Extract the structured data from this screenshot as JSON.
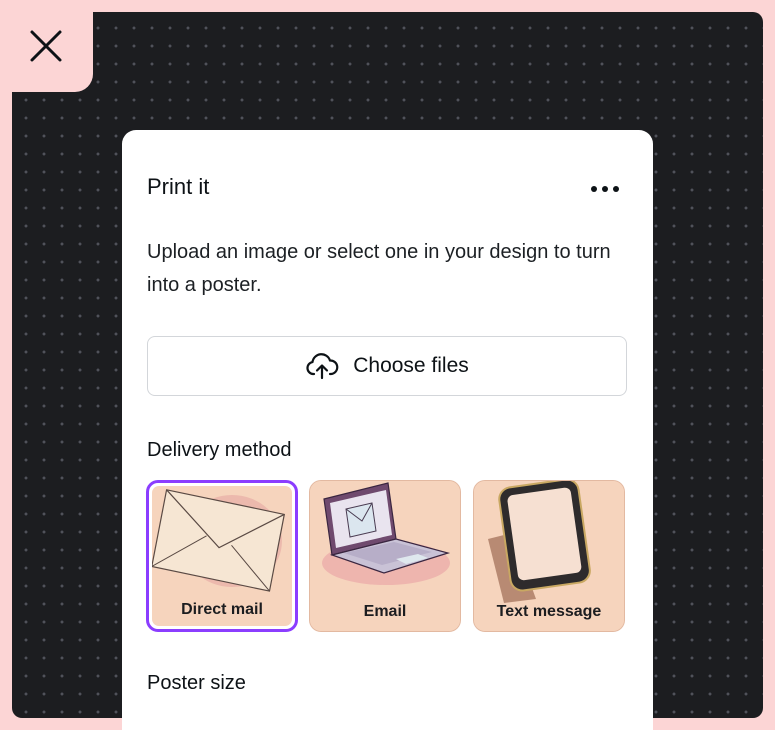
{
  "close": {
    "icon": "close-icon"
  },
  "panel": {
    "title": "Print it",
    "more_icon": "more-horizontal-icon",
    "description": "Upload an image or select one in your design to turn into a poster.",
    "upload_button_label": "Choose files",
    "upload_icon": "cloud-upload-icon",
    "delivery_label": "Delivery method",
    "delivery_options": [
      {
        "label": "Direct mail",
        "selected": true,
        "icon": "envelope-icon"
      },
      {
        "label": "Email",
        "selected": false,
        "icon": "laptop-email-icon"
      },
      {
        "label": "Text message",
        "selected": false,
        "icon": "phone-icon"
      }
    ],
    "poster_size_label": "Poster size"
  },
  "colors": {
    "frame": "#fcd5d5",
    "canvas": "#1c1d20",
    "selected_border": "#8b3dff",
    "card_bg": "#f6d4bd"
  }
}
